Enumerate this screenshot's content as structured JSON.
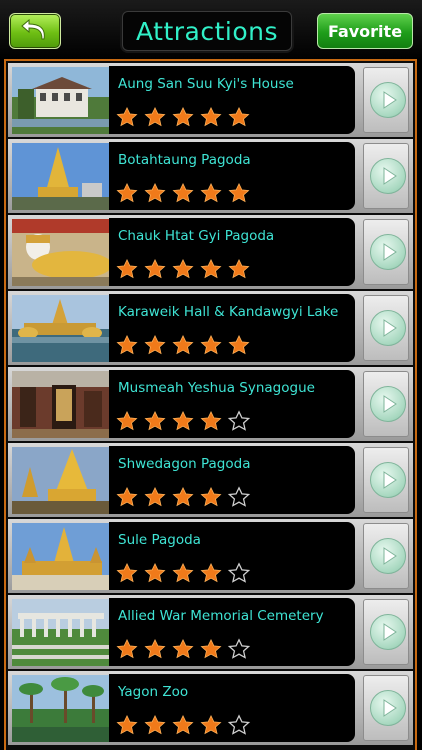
{
  "header": {
    "title": "Attractions",
    "favorite_label": "Favorite",
    "back_icon": "back-arrow-icon"
  },
  "colors": {
    "title_text": "#31f0c8",
    "item_name": "#3fe4d4",
    "star_filled": "#f07a1a",
    "accent_border": "#c86a12"
  },
  "items": [
    {
      "name": "Aung San Suu Kyi's House",
      "rating": 5
    },
    {
      "name": "Botahtaung Pagoda",
      "rating": 5
    },
    {
      "name": "Chauk Htat Gyi Pagoda",
      "rating": 5
    },
    {
      "name": "Karaweik Hall & Kandawgyi Lake",
      "rating": 5
    },
    {
      "name": "Musmeah Yeshua Synagogue",
      "rating": 4
    },
    {
      "name": "Shwedagon Pagoda",
      "rating": 4
    },
    {
      "name": "Sule Pagoda",
      "rating": 4
    },
    {
      "name": "Allied War Memorial Cemetery",
      "rating": 4
    },
    {
      "name": "Yagon Zoo",
      "rating": 4
    }
  ]
}
